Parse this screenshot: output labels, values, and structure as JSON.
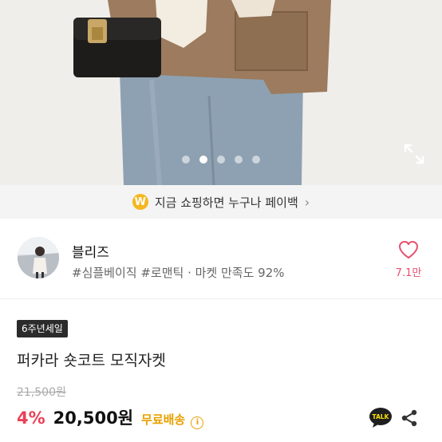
{
  "image": {
    "carousel_total": 5,
    "carousel_active_index": 1,
    "expand_icon": "expand-icon"
  },
  "banner": {
    "coin_letter": "W",
    "text": "지금 쇼핑하면 누구나 페이백",
    "chevron": "›"
  },
  "shop": {
    "name": "블리즈",
    "tags": "#심플베이직 #로맨틱 · 마켓 만족도 92%",
    "likes": "7.1만",
    "heart_icon": "heart-icon"
  },
  "product": {
    "badge": "6주년세일",
    "title": "퍼카라 숏코트 모직자켓",
    "original_price": "21,500원",
    "discount": "4%",
    "price": "20,500원",
    "shipping": "무료배송",
    "info_glyph": "i"
  },
  "actions": {
    "talk_label": "TALK",
    "share_icon": "share-icon"
  },
  "colors": {
    "accent_red": "#e84057",
    "shipping_orange": "#e8a000",
    "coin_yellow": "#f5b720",
    "kakao_yellow": "#fae100"
  }
}
